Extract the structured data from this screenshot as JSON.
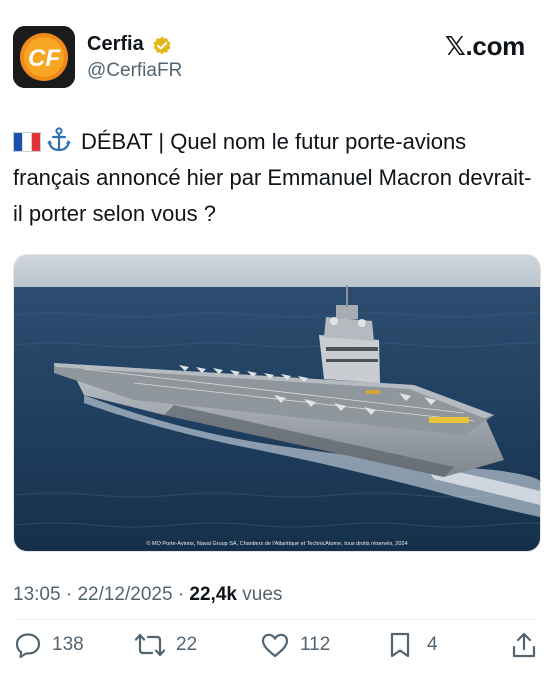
{
  "header": {
    "author_name": "Cerfia",
    "handle": "@CerfiaFR",
    "brand": "𝕏.com",
    "avatar_logo_text": "CF"
  },
  "tweet": {
    "text": "DÉBAT | Quel nom le futur porte-avions français annoncé hier par Emmanuel Macron devrait-il porter selon vous ?",
    "flag_icon": "france-flag",
    "anchor_icon": "anchor-icon"
  },
  "media": {
    "caption": "© MO Porte-Avions, Naval Group SA, Chantiers de l'Atlantique et TechnicAtome, tous droits réservés, 2024"
  },
  "meta": {
    "time": "13:05",
    "separator": "·",
    "date": "22/12/2025",
    "views_count": "22,4k",
    "views_label": "vues"
  },
  "actions": {
    "replies": "138",
    "reposts": "22",
    "likes": "112",
    "bookmarks": "4"
  },
  "colors": {
    "text": "#0f1419",
    "secondary": "#536471",
    "verified": "#e2b719",
    "avatar_bg": "#1b1b1b",
    "avatar_accent": "#f39a1d"
  }
}
